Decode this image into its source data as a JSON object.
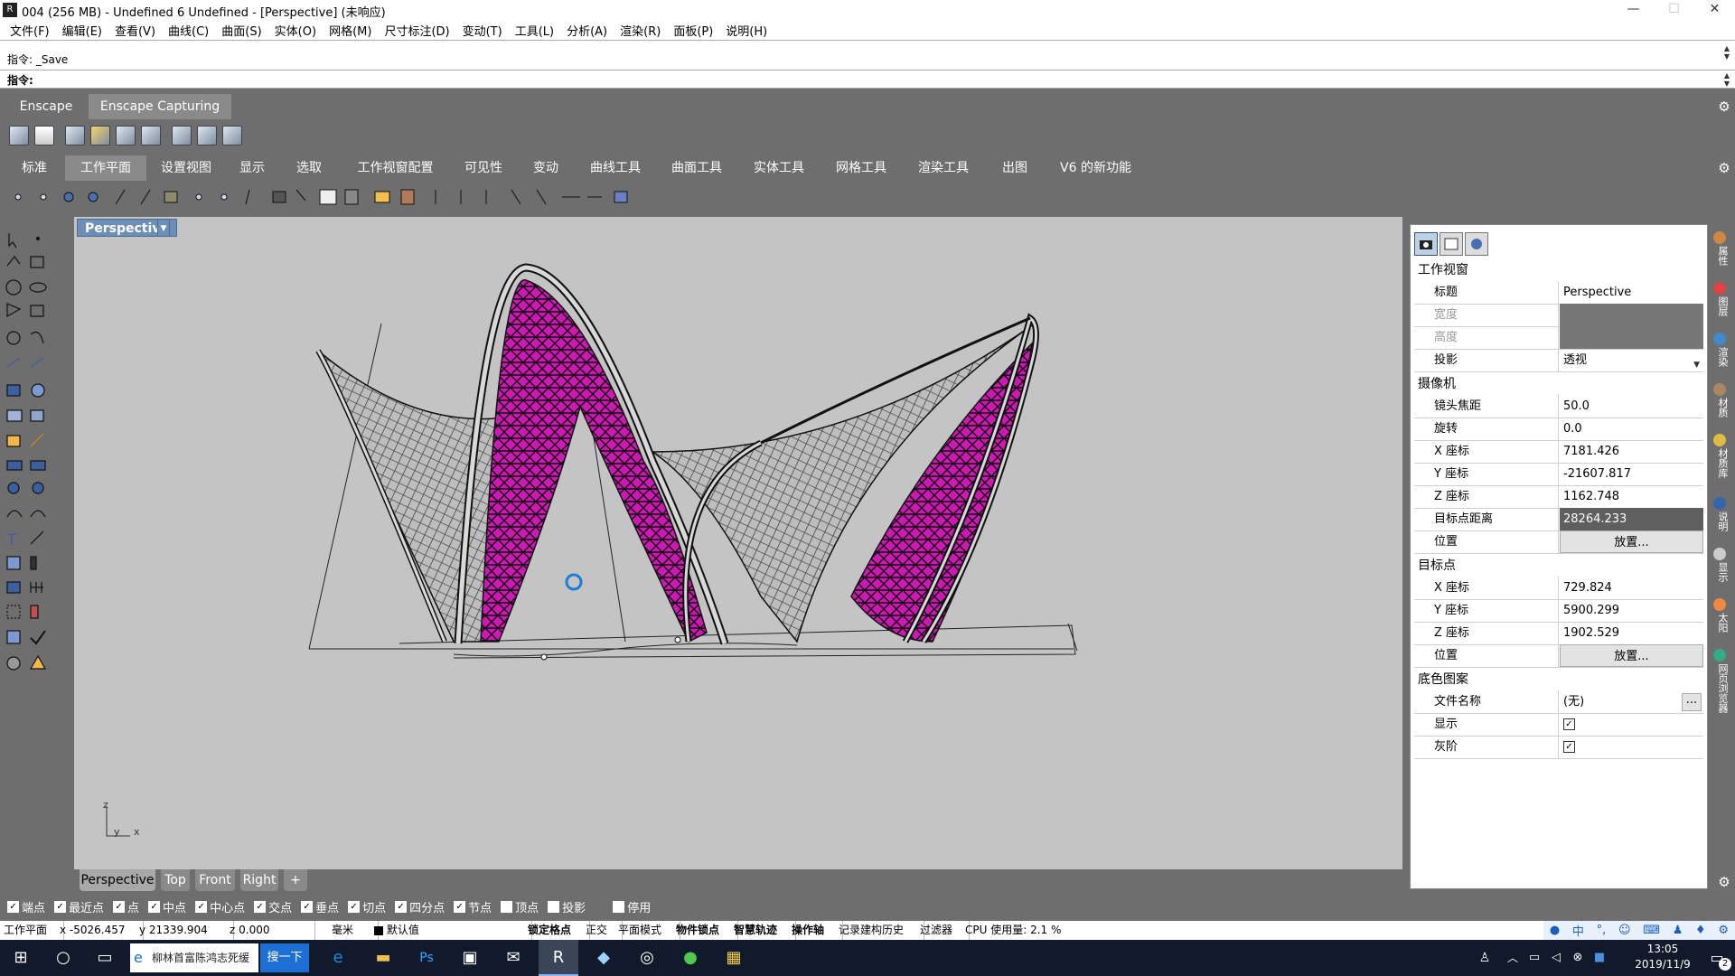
{
  "window": {
    "title": "004 (256 MB) - Undefined 6 Undefined - [Perspective] (未响应)",
    "minimize": "—",
    "maximize": "☐",
    "close": "✕"
  },
  "menu": [
    "文件(F)",
    "编辑(E)",
    "查看(V)",
    "曲线(C)",
    "曲面(S)",
    "实体(O)",
    "网格(M)",
    "尺寸标注(D)",
    "变动(T)",
    "工具(L)",
    "分析(A)",
    "渲染(R)",
    "面板(P)",
    "说明(H)"
  ],
  "command": {
    "history_line": "指令: _Save",
    "prompt": "指令:"
  },
  "toolbar_tabs_top": [
    "Enscape",
    "Enscape Capturing"
  ],
  "toolbar_tabs_main": [
    "标准",
    "工作平面",
    "设置视图",
    "显示",
    "选取",
    "工作视窗配置",
    "可见性",
    "变动",
    "曲线工具",
    "曲面工具",
    "实体工具",
    "网格工具",
    "渲染工具",
    "出图",
    "V6 的新功能"
  ],
  "viewport": {
    "label": "Perspective",
    "axis_z": "z",
    "axis_y": "y",
    "axis_x": "x",
    "tabs": [
      "Perspective",
      "Top",
      "Front",
      "Right",
      "+"
    ]
  },
  "properties": {
    "section_viewport": "工作视窗",
    "title_label": "标题",
    "title_value": "Perspective",
    "width_label": "宽度",
    "height_label": "高度",
    "projection_label": "投影",
    "projection_value": "透视",
    "section_camera": "摄像机",
    "lens_label": "镜头焦距",
    "lens_value": "50.0",
    "rotation_label": "旋转",
    "rotation_value": "0.0",
    "cx_label": "X 座标",
    "cx_value": "7181.426",
    "cy_label": "Y 座标",
    "cy_value": "-21607.817",
    "cz_label": "Z 座标",
    "cz_value": "1162.748",
    "dist_label": "目标点距离",
    "dist_value": "28264.233",
    "cpos_label": "位置",
    "cpos_button": "放置...",
    "section_target": "目标点",
    "tx_label": "X 座标",
    "tx_value": "729.824",
    "ty_label": "Y 座标",
    "ty_value": "5900.299",
    "tz_label": "Z 座标",
    "tz_value": "1902.529",
    "tpos_label": "位置",
    "tpos_button": "放置...",
    "section_wallpaper": "底色图案",
    "file_label": "文件名称",
    "file_value": "(无)",
    "file_button": "...",
    "show_label": "显示",
    "gray_label": "灰阶"
  },
  "right_side_tabs": [
    "属性",
    "图层",
    "渲染",
    "材质",
    "材质库",
    "说明",
    "显示",
    "太阳",
    "网页浏览器"
  ],
  "osnap": [
    {
      "label": "端点",
      "on": true
    },
    {
      "label": "最近点",
      "on": true
    },
    {
      "label": "点",
      "on": true
    },
    {
      "label": "中点",
      "on": true
    },
    {
      "label": "中心点",
      "on": true
    },
    {
      "label": "交点",
      "on": true
    },
    {
      "label": "垂点",
      "on": true
    },
    {
      "label": "切点",
      "on": true
    },
    {
      "label": "四分点",
      "on": true
    },
    {
      "label": "节点",
      "on": true
    },
    {
      "label": "顶点",
      "on": false
    },
    {
      "label": "投影",
      "on": false
    },
    {
      "label": "停用",
      "on": false
    }
  ],
  "status": {
    "plane": "工作平面",
    "x": "x -5026.457",
    "y": "y 21339.904",
    "z": "z 0.000",
    "unit": "毫米",
    "layer": "默认值",
    "grid_snap": "锁定格点",
    "ortho": "正交",
    "planar": "平面模式",
    "osnap": "物件锁点",
    "smarttrack": "智慧轨迹",
    "gumball": "操作轴",
    "history": "记录建构历史",
    "filter": "过滤器",
    "cpu": "CPU 使用量: 2.1 %"
  },
  "taskbar": {
    "search_text": "柳林首富陈鸿志死缓",
    "search_button": "搜一下",
    "time": "13:05",
    "date": "2019/11/9",
    "ime": "中",
    "notify_count": "2"
  }
}
